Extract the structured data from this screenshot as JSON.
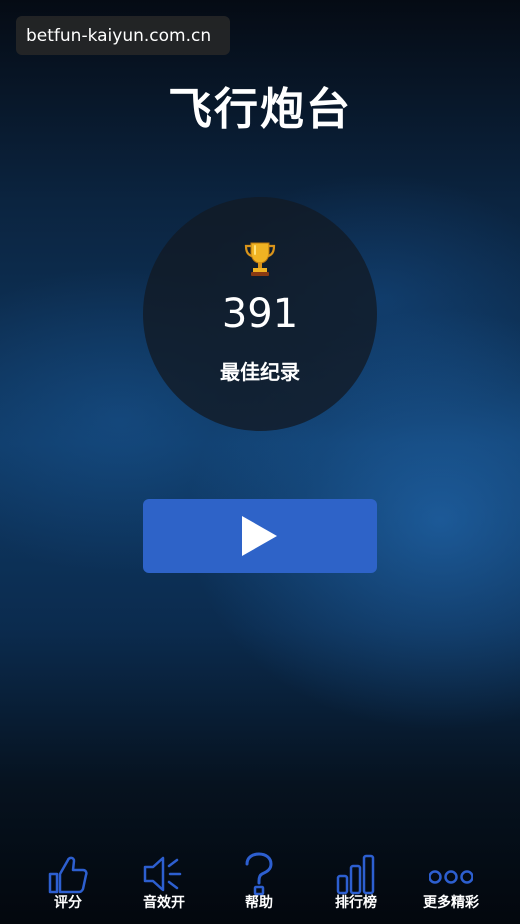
{
  "watermark": {
    "text": "betfun-kaiyun.com.cn"
  },
  "game": {
    "title": "飞行炮台"
  },
  "record": {
    "icon": "trophy-icon",
    "score": "391",
    "label": "最佳纪录"
  },
  "play": {
    "icon": "play-icon"
  },
  "bottom_bar": {
    "icon_color": "#2d5fd0",
    "items": [
      {
        "label": "评分",
        "icon": "thumbs-up-icon"
      },
      {
        "label": "音效开",
        "icon": "speaker-icon"
      },
      {
        "label": "帮助",
        "icon": "question-icon"
      },
      {
        "label": "排行榜",
        "icon": "bar-chart-icon"
      },
      {
        "label": "更多精彩",
        "icon": "more-icon"
      }
    ]
  },
  "colors": {
    "play_button": "#2e63c8",
    "record_circle": "#121a24",
    "trophy_gold": "#f0b323"
  }
}
